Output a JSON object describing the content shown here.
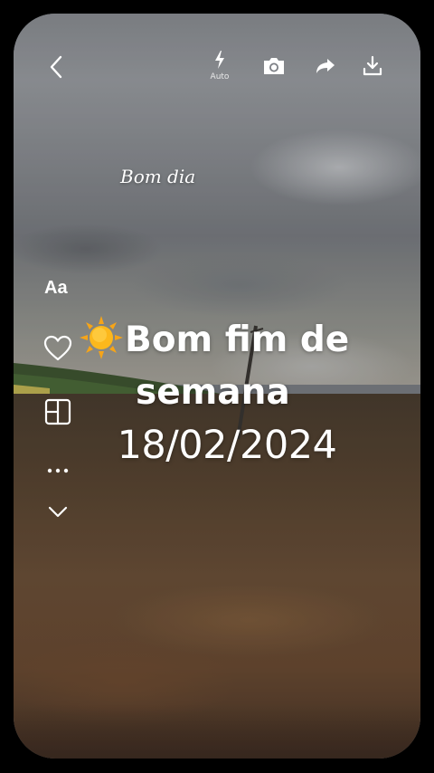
{
  "top_bar": {
    "back_icon": "chevron-left-icon",
    "flash_icon": "flash-icon",
    "flash_label": "Auto",
    "camera_icon": "camera-icon",
    "share_icon": "share-arrow-icon",
    "download_icon": "download-icon"
  },
  "left_tools": {
    "text_label": "Aa",
    "heart_icon": "heart-outline-icon",
    "layout_icon": "layout-grid-icon",
    "more_icon": "more-dots-icon",
    "collapse_icon": "chevron-down-icon"
  },
  "overlay": {
    "script_text": "Bom dia",
    "sun_emoji": "sun-emoji",
    "headline_line1": "Bom fim de",
    "headline_line2": "semana",
    "date": "18/02/2024"
  },
  "colors": {
    "frame_border": "#000000",
    "text": "#ffffff"
  }
}
